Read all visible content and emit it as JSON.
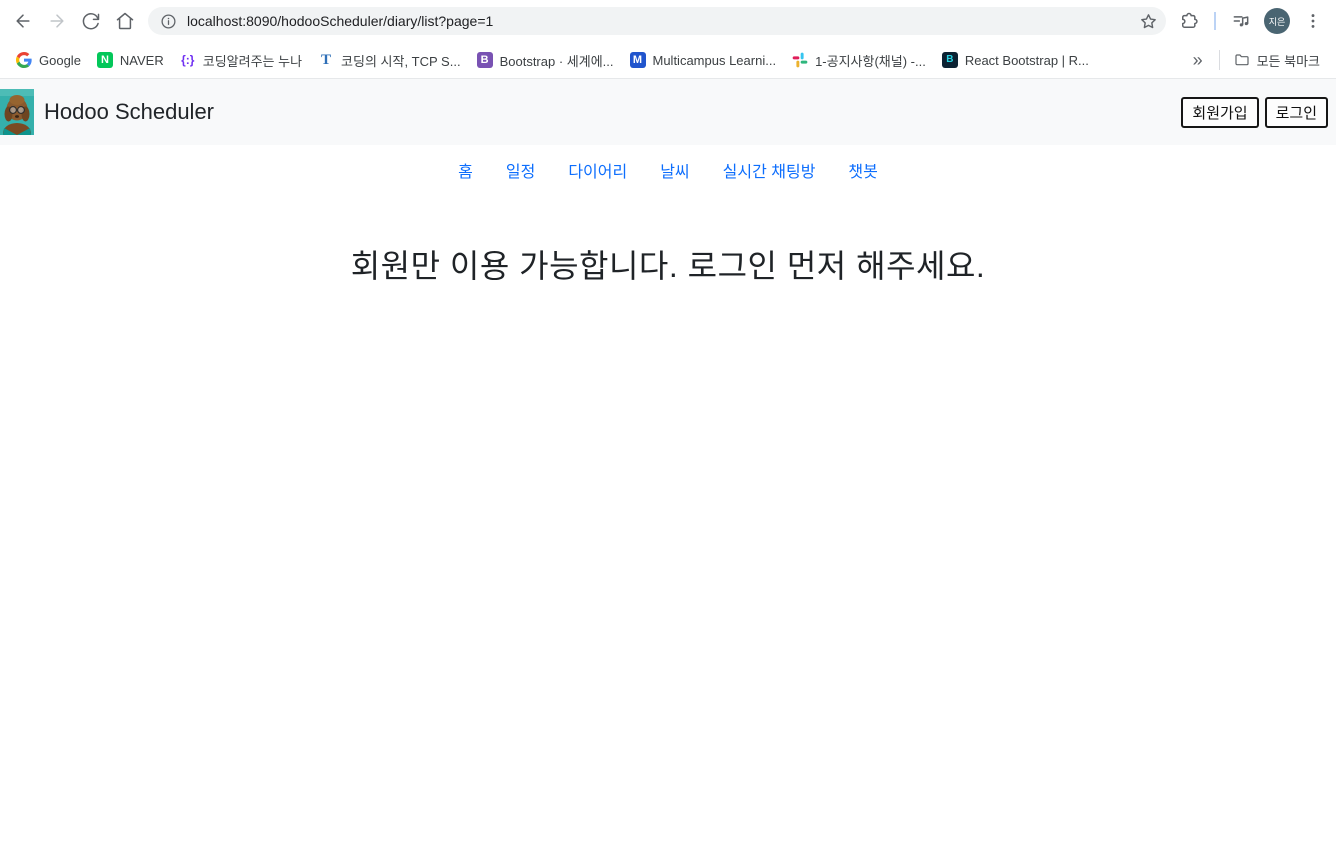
{
  "browser": {
    "toolbar": {
      "url": "localhost:8090/hodooScheduler/diary/list?page=1",
      "profile_initials": "지은"
    },
    "bookmarks_bar": {
      "items": [
        {
          "label": "Google"
        },
        {
          "label": "NAVER",
          "icon_text": "N"
        },
        {
          "label": "코딩알려주는 누나",
          "icon_text": "{:}"
        },
        {
          "label": "코딩의 시작, TCP S...",
          "icon_text": "T"
        },
        {
          "label": "Bootstrap · 세계에...",
          "icon_text": "B"
        },
        {
          "label": "Multicampus Learni...",
          "icon_text": "M"
        },
        {
          "label": "1-공지사항(채널) -..."
        },
        {
          "label": "React Bootstrap | R...",
          "icon_text": "B"
        }
      ],
      "overflow_chevron": "»",
      "all_bookmarks_label": "모든 북마크"
    }
  },
  "page": {
    "header": {
      "title": "Hodoo Scheduler",
      "signup_button": "회원가입",
      "login_button": "로그인"
    },
    "nav": {
      "items": [
        {
          "label": "홈"
        },
        {
          "label": "일정"
        },
        {
          "label": "다이어리"
        },
        {
          "label": "날씨"
        },
        {
          "label": "실시간 채팅방"
        },
        {
          "label": "챗봇"
        }
      ]
    },
    "main": {
      "message": "회원만 이용 가능합니다. 로그인 먼저 해주세요."
    }
  },
  "colors": {
    "nav_link_blue": "#0d6efd",
    "site_header_bg": "#f8f9fa",
    "avatar_bg": "#4a6572",
    "urlbar_bg": "#f1f3f4",
    "toolbar_icon_gray": "#5f6368",
    "naver_green": "#03c75a",
    "bootstrap_purple": "#7952b3",
    "logo_teal": "#35b0ab"
  }
}
